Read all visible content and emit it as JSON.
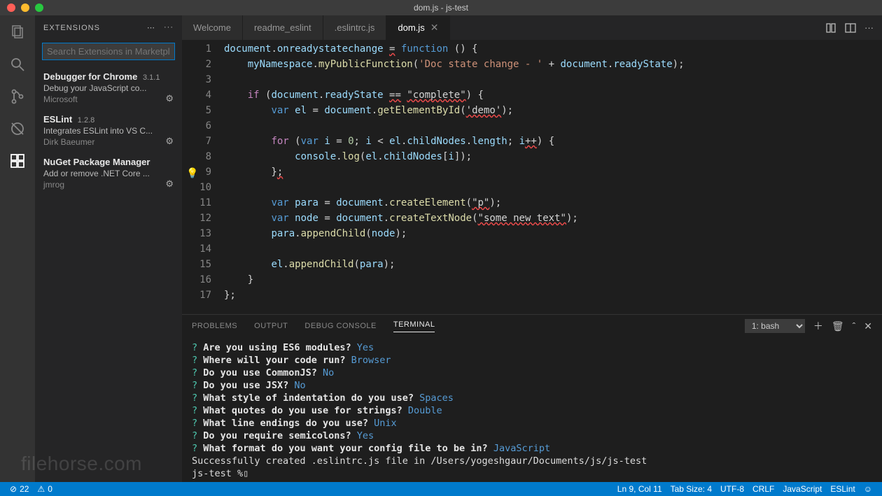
{
  "window": {
    "title": "dom.js - js-test"
  },
  "sidebar": {
    "title": "EXTENSIONS",
    "searchPlaceholder": "Search Extensions in Marketplace",
    "items": [
      {
        "name": "Debugger for Chrome",
        "version": "3.1.1",
        "desc": "Debug your JavaScript co...",
        "publisher": "Microsoft"
      },
      {
        "name": "ESLint",
        "version": "1.2.8",
        "desc": "Integrates ESLint into VS C...",
        "publisher": "Dirk Baeumer"
      },
      {
        "name": "NuGet Package Manager",
        "version": "",
        "desc": "Add or remove .NET Core ...",
        "publisher": "jmrog"
      }
    ]
  },
  "tabs": [
    {
      "label": "Welcome",
      "active": false
    },
    {
      "label": "readme_eslint",
      "active": false
    },
    {
      "label": ".eslintrc.js",
      "active": false
    },
    {
      "label": "dom.js",
      "active": true
    }
  ],
  "code": {
    "lines": [
      [
        [
          "v",
          "document"
        ],
        [
          "p",
          "."
        ],
        [
          "v",
          "onreadystatechange"
        ],
        [
          "p",
          " "
        ],
        [
          "err",
          "="
        ],
        [
          "p",
          " "
        ],
        [
          "kd",
          "function"
        ],
        [
          "p",
          " () {"
        ]
      ],
      [
        [
          "p",
          "    "
        ],
        [
          "v",
          "myNamespace"
        ],
        [
          "p",
          "."
        ],
        [
          "fn",
          "myPublicFunction"
        ],
        [
          "p",
          "("
        ],
        [
          "s",
          "'Doc state change - '"
        ],
        [
          "p",
          " + "
        ],
        [
          "v",
          "document"
        ],
        [
          "p",
          "."
        ],
        [
          "v",
          "readyState"
        ],
        [
          "p",
          ");"
        ]
      ],
      [],
      [
        [
          "p",
          "    "
        ],
        [
          "k",
          "if"
        ],
        [
          "p",
          " ("
        ],
        [
          "v",
          "document"
        ],
        [
          "p",
          "."
        ],
        [
          "v",
          "readyState"
        ],
        [
          "p",
          " "
        ],
        [
          "err",
          "=="
        ],
        [
          "p",
          " "
        ],
        [
          "err",
          "\"complete\""
        ],
        [
          "p",
          ") {"
        ]
      ],
      [
        [
          "p",
          "        "
        ],
        [
          "kd",
          "var"
        ],
        [
          "p",
          " "
        ],
        [
          "v",
          "el"
        ],
        [
          "p",
          " = "
        ],
        [
          "v",
          "document"
        ],
        [
          "p",
          "."
        ],
        [
          "fn",
          "getElementById"
        ],
        [
          "p",
          "("
        ],
        [
          "err",
          "'demo'"
        ],
        [
          "p",
          ");"
        ]
      ],
      [],
      [
        [
          "p",
          "        "
        ],
        [
          "k",
          "for"
        ],
        [
          "p",
          " ("
        ],
        [
          "kd",
          "var"
        ],
        [
          "p",
          " "
        ],
        [
          "v",
          "i"
        ],
        [
          "p",
          " = "
        ],
        [
          "n",
          "0"
        ],
        [
          "p",
          "; "
        ],
        [
          "v",
          "i"
        ],
        [
          "p",
          " < "
        ],
        [
          "v",
          "el"
        ],
        [
          "p",
          "."
        ],
        [
          "v",
          "childNodes"
        ],
        [
          "p",
          "."
        ],
        [
          "v",
          "length"
        ],
        [
          "p",
          "; "
        ],
        [
          "v",
          "i"
        ],
        [
          "err",
          "++"
        ],
        [
          "p",
          ") {"
        ]
      ],
      [
        [
          "p",
          "            "
        ],
        [
          "v",
          "console"
        ],
        [
          "p",
          "."
        ],
        [
          "fn",
          "log"
        ],
        [
          "p",
          "("
        ],
        [
          "v",
          "el"
        ],
        [
          "p",
          "."
        ],
        [
          "v",
          "childNodes"
        ],
        [
          "p",
          "["
        ],
        [
          "v",
          "i"
        ],
        [
          "p",
          "]);"
        ]
      ],
      [
        [
          "p",
          "        }"
        ],
        [
          "err",
          ";"
        ]
      ],
      [],
      [
        [
          "p",
          "        "
        ],
        [
          "kd",
          "var"
        ],
        [
          "p",
          " "
        ],
        [
          "v",
          "para"
        ],
        [
          "p",
          " = "
        ],
        [
          "v",
          "document"
        ],
        [
          "p",
          "."
        ],
        [
          "fn",
          "createElement"
        ],
        [
          "p",
          "("
        ],
        [
          "err",
          "\"p\""
        ],
        [
          "p",
          ");"
        ]
      ],
      [
        [
          "p",
          "        "
        ],
        [
          "kd",
          "var"
        ],
        [
          "p",
          " "
        ],
        [
          "v",
          "node"
        ],
        [
          "p",
          " = "
        ],
        [
          "v",
          "document"
        ],
        [
          "p",
          "."
        ],
        [
          "fn",
          "createTextNode"
        ],
        [
          "p",
          "("
        ],
        [
          "err",
          "\"some new text\""
        ],
        [
          "p",
          ");"
        ]
      ],
      [
        [
          "p",
          "        "
        ],
        [
          "v",
          "para"
        ],
        [
          "p",
          "."
        ],
        [
          "fn",
          "appendChild"
        ],
        [
          "p",
          "("
        ],
        [
          "v",
          "node"
        ],
        [
          "p",
          ");"
        ]
      ],
      [],
      [
        [
          "p",
          "        "
        ],
        [
          "v",
          "el"
        ],
        [
          "p",
          "."
        ],
        [
          "fn",
          "appendChild"
        ],
        [
          "p",
          "("
        ],
        [
          "v",
          "para"
        ],
        [
          "p",
          ");"
        ]
      ],
      [
        [
          "p",
          "    }"
        ]
      ],
      [
        [
          "p",
          "};"
        ]
      ]
    ]
  },
  "panel": {
    "tabs": [
      "PROBLEMS",
      "OUTPUT",
      "DEBUG CONSOLE",
      "TERMINAL"
    ],
    "activeTab": 3,
    "selector": "1: bash",
    "lines": [
      {
        "q": "?",
        "w": "Are you using ES6 modules?",
        "a": "Yes"
      },
      {
        "q": "?",
        "w": "Where will your code run?",
        "a": "Browser"
      },
      {
        "q": "?",
        "w": "Do you use CommonJS?",
        "a": "No"
      },
      {
        "q": "?",
        "w": "Do you use JSX?",
        "a": "No"
      },
      {
        "q": "?",
        "w": "What style of indentation do you use?",
        "a": "Spaces"
      },
      {
        "q": "?",
        "w": "What quotes do you use for strings?",
        "a": "Double"
      },
      {
        "q": "?",
        "w": "What line endings do you use?",
        "a": "Unix"
      },
      {
        "q": "?",
        "w": "Do you require semicolons?",
        "a": "Yes"
      },
      {
        "q": "?",
        "w": "What format do you want your config file to be in?",
        "a": "JavaScript"
      }
    ],
    "finalLines": [
      "Successfully created .eslintrc.js file in /Users/yogeshgaur/Documents/js/js-test",
      "js-test %▯"
    ]
  },
  "status": {
    "errors": "22",
    "warnings": "0",
    "ln": "Ln 9, Col 11",
    "tab": "Tab Size: 4",
    "enc": "UTF-8",
    "eol": "CRLF",
    "lang": "JavaScript",
    "lint": "ESLint"
  },
  "watermark": "filehorse.com"
}
